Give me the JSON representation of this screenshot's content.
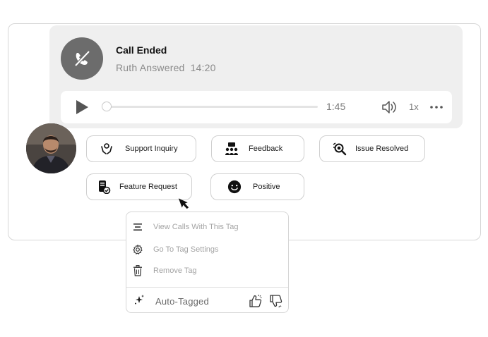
{
  "call": {
    "status": "Call Ended",
    "answered_by": "Ruth Answered",
    "timestamp": "14:20",
    "icon": "phone-ended-icon"
  },
  "player": {
    "duration": "1:45",
    "speed": "1x",
    "progress_fraction": 0.0
  },
  "tags": {
    "support_inquiry": "Support Inquiry",
    "feedback": "Feedback",
    "issue_resolved": "Issue Resolved",
    "feature_request": "Feature Request",
    "positive": "Positive"
  },
  "menu": {
    "view_calls": "View Calls With This Tag",
    "tag_settings": "Go To Tag Settings",
    "remove_tag": "Remove Tag",
    "auto_tagged": "Auto-Tagged"
  },
  "colors": {
    "panel_bg": "#efefef",
    "call_icon_bg": "#6c6c6c",
    "muted_text": "#8a8a8a"
  }
}
